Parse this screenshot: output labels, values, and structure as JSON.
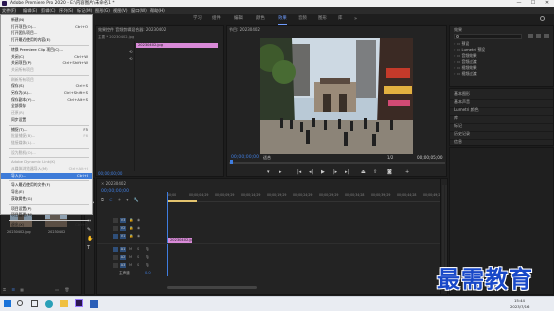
{
  "app": {
    "title": "Adobe Premiere Pro 2020 - E:\\内容图片\\未命名1 *",
    "window_controls": [
      "—",
      "☐",
      "✕"
    ]
  },
  "menubar": {
    "items": [
      "文件(F)",
      "编辑(E)",
      "剪辑(C)",
      "序列(S)",
      "标记(M)",
      "图形(G)",
      "视图(V)",
      "窗口(W)",
      "帮助(H)"
    ]
  },
  "workspaces": {
    "items": [
      "学习",
      "组件",
      "编辑",
      "颜色",
      "效果",
      "音频",
      "图形",
      "库"
    ],
    "active": "效果"
  },
  "file_menu": {
    "items": [
      {
        "label": "新建(N)",
        "shortcut": ""
      },
      {
        "label": "打开项目(O)...",
        "shortcut": "Ctrl+O"
      },
      {
        "label": "打开团队项目...",
        "shortcut": ""
      },
      {
        "label": "打开最近使用的内容(E)",
        "shortcut": ""
      },
      {
        "label": "转换 Premiere Clip 项目(C)...",
        "shortcut": ""
      },
      {
        "label": "关闭(C)",
        "shortcut": "Ctrl+W"
      },
      {
        "label": "关闭项目(P)",
        "shortcut": "Ctrl+Shift+W"
      },
      {
        "label": "关闭所有项目",
        "shortcut": ""
      },
      {
        "label": "刷新所有项目",
        "shortcut": ""
      },
      {
        "label": "保存(S)",
        "shortcut": "Ctrl+S"
      },
      {
        "label": "另存为(A)...",
        "shortcut": "Ctrl+Shift+S"
      },
      {
        "label": "保存副本(Y)...",
        "shortcut": "Ctrl+Alt+S"
      },
      {
        "label": "全部保存",
        "shortcut": ""
      },
      {
        "label": "还原(R)",
        "shortcut": ""
      },
      {
        "label": "同步设置",
        "shortcut": ""
      },
      {
        "label": "捕捉(T)...",
        "shortcut": "F5"
      },
      {
        "label": "批量捕捉(B)...",
        "shortcut": "F6"
      },
      {
        "label": "链接媒体(L)...",
        "shortcut": ""
      },
      {
        "label": "设为脱机(O)...",
        "shortcut": ""
      },
      {
        "label": "Adobe Dynamic Link(K)",
        "shortcut": ""
      },
      {
        "label": "从媒体浏览器导入(M)",
        "shortcut": "Ctrl+Alt+I"
      },
      {
        "label": "导入(I)...",
        "shortcut": "Ctrl+I"
      },
      {
        "label": "导入最近使用的文件(F)",
        "shortcut": ""
      },
      {
        "label": "导出(E)",
        "shortcut": ""
      },
      {
        "label": "获取属性(G)",
        "shortcut": ""
      },
      {
        "label": "项目设置(P)",
        "shortcut": ""
      },
      {
        "label": "项目管理(M)...",
        "shortcut": ""
      },
      {
        "label": "退出(X)",
        "shortcut": "Ctrl+Q"
      }
    ],
    "disabled_indices": [
      7,
      8,
      13,
      16,
      17,
      18,
      19,
      20
    ],
    "highlighted": "导入(I)..."
  },
  "source_panel": {
    "header": "效果控件  音频剪辑混合器: 20230402",
    "master_label": "主要 * 20230402.jpg",
    "clip_label": "20230402.jpg"
  },
  "program_monitor": {
    "title": "节目: 20230402",
    "timecode_left": "00;00;00;00",
    "fit": "适合",
    "ratio": "1/2",
    "timecode_right": "00;00;05;00"
  },
  "effects_panel": {
    "title": "效果",
    "search_placeholder": "",
    "tree": [
      "预设",
      "Lumetri 预设",
      "音频效果",
      "音频过渡",
      "视频效果",
      "视频过渡"
    ],
    "sections": [
      "基本图形",
      "基本声音",
      "Lumetri 颜色",
      "库",
      "标记",
      "历史记录",
      "信息"
    ]
  },
  "project_panel": {
    "title": "项目: 未命名1",
    "items": [
      {
        "name": "20230402.jpg",
        "duration": "5:00"
      },
      {
        "name": "20230402",
        "duration": "5:00"
      }
    ]
  },
  "timeline": {
    "tab": "20230402",
    "timecode": "00;00;00;00",
    "ruler": [
      "00;00",
      "00;00;04;29",
      "00;00;09;29",
      "00;00;14;29",
      "00;00;19;29",
      "00;00;24;29",
      "00;00;29;29",
      "00;00;34;28",
      "00;00;39;29",
      "00;00;44;28",
      "00;00;49;29"
    ],
    "video_tracks": [
      "V3",
      "V2",
      "V1"
    ],
    "audio_tracks": [
      "A1",
      "A2",
      "A3"
    ],
    "master": "主声道",
    "master_value": "0.0",
    "clip_label": "20230402.jpg"
  },
  "taskbar": {
    "time": "15:44",
    "date": "2023/7/16"
  },
  "watermark": "最需教育",
  "colors": {
    "accent": "#3f7de0",
    "clip": "#d98ad8",
    "highlight": "#3d7bd8"
  }
}
